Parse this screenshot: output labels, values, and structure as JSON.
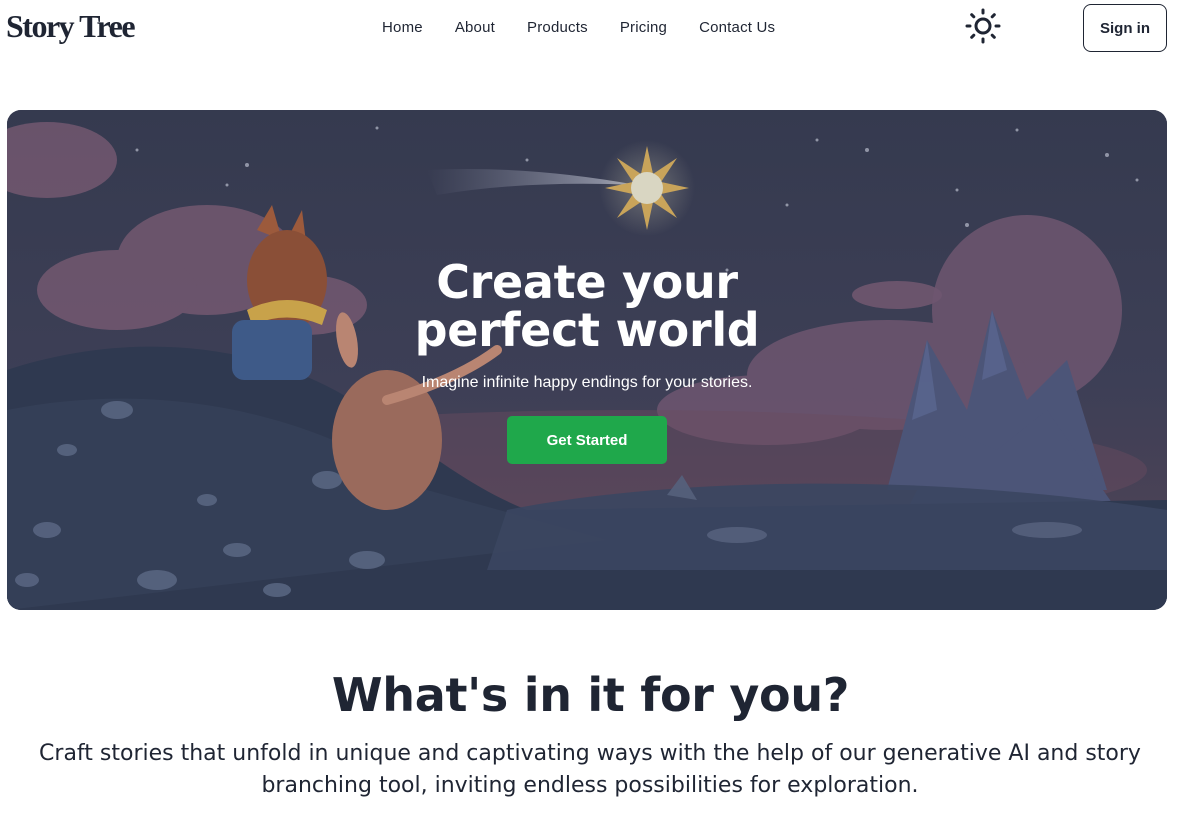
{
  "header": {
    "logo": "Story Tree",
    "nav": [
      {
        "label": "Home"
      },
      {
        "label": "About"
      },
      {
        "label": "Products"
      },
      {
        "label": "Pricing"
      },
      {
        "label": "Contact Us"
      }
    ],
    "theme_icon": "sun-icon",
    "signin_label": "Sign in"
  },
  "hero": {
    "title_line1": "Create your",
    "title_line2": "perfect world",
    "subtitle": "Imagine infinite happy endings for your stories.",
    "cta_label": "Get Started",
    "cta_color": "#1fa84b"
  },
  "features": {
    "title": "What's in it for you?",
    "description": "Craft stories that unfold in unique and captivating ways with the help of our generative AI and story branching tool, inviting endless possibilities for exploration."
  },
  "colors": {
    "text": "#1f2533",
    "hero_bg": "#3a3f55",
    "accent": "#1fa84b"
  }
}
